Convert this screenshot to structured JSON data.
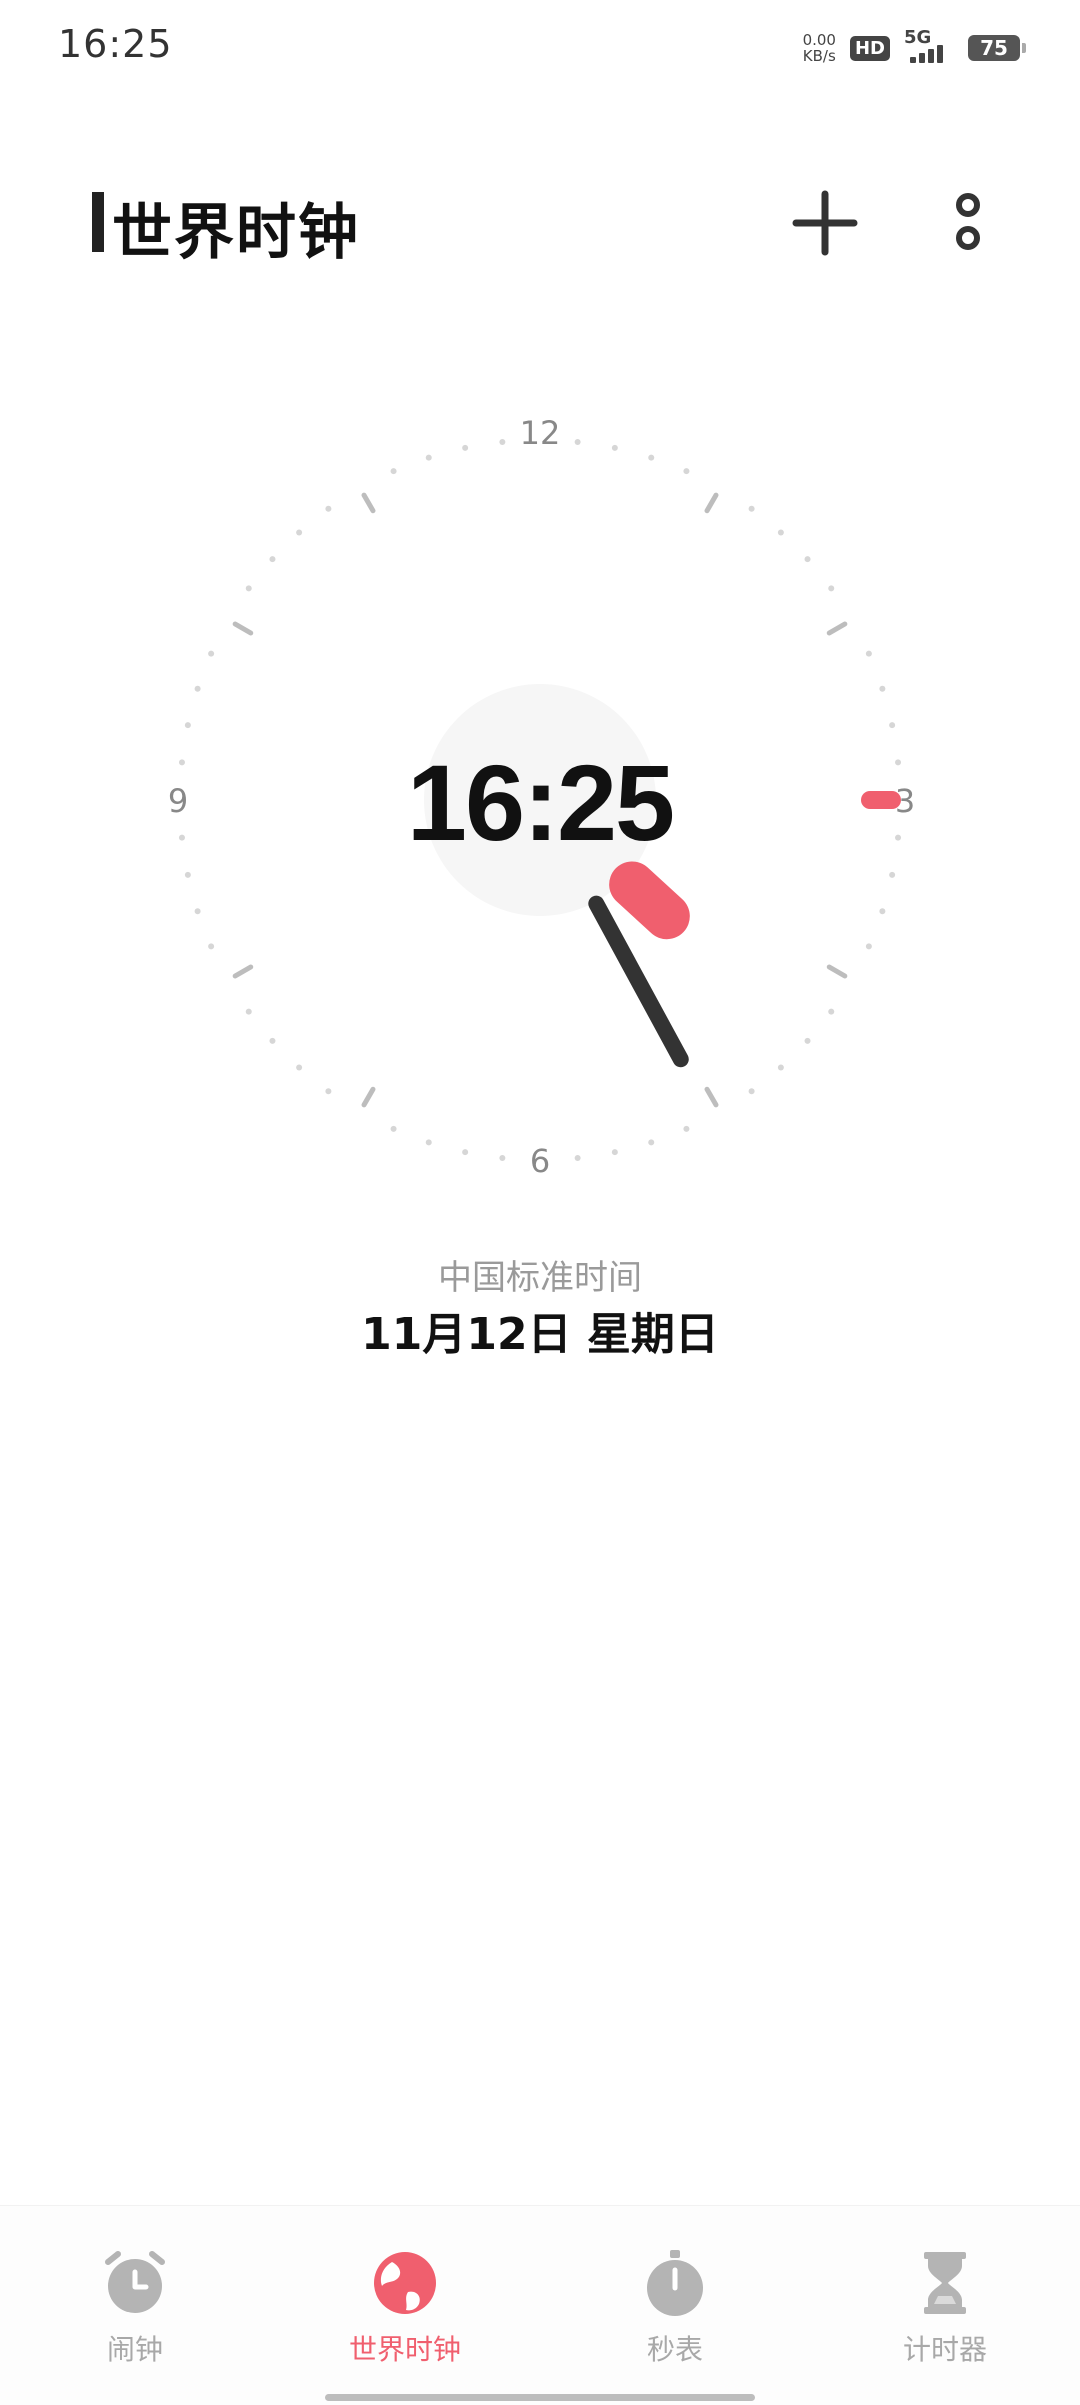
{
  "status_bar": {
    "time": "16:25",
    "net_speed_value": "0.00",
    "net_speed_unit": "KB/s",
    "hd_label": "HD",
    "network_type": "5G",
    "battery": "75"
  },
  "header": {
    "title": "世界时钟",
    "add_icon": "plus-icon",
    "more_icon": "more-vertical-icon"
  },
  "clock": {
    "digital_time": "16:25",
    "numerals": {
      "twelve": "12",
      "three": "3",
      "six": "6",
      "nine": "9"
    },
    "hour": 16,
    "minute": 25,
    "second": 15,
    "accent_color": "#f05f6e",
    "hand_color": "#333333"
  },
  "city": {
    "timezone_name": "中国标准时间",
    "date": "11月12日 星期日"
  },
  "bottom_nav": {
    "items": [
      {
        "label": "闹钟",
        "icon": "alarm-clock-icon",
        "active": false
      },
      {
        "label": "世界时钟",
        "icon": "globe-icon",
        "active": true
      },
      {
        "label": "秒表",
        "icon": "stopwatch-icon",
        "active": false
      },
      {
        "label": "计时器",
        "icon": "hourglass-icon",
        "active": false
      }
    ]
  }
}
